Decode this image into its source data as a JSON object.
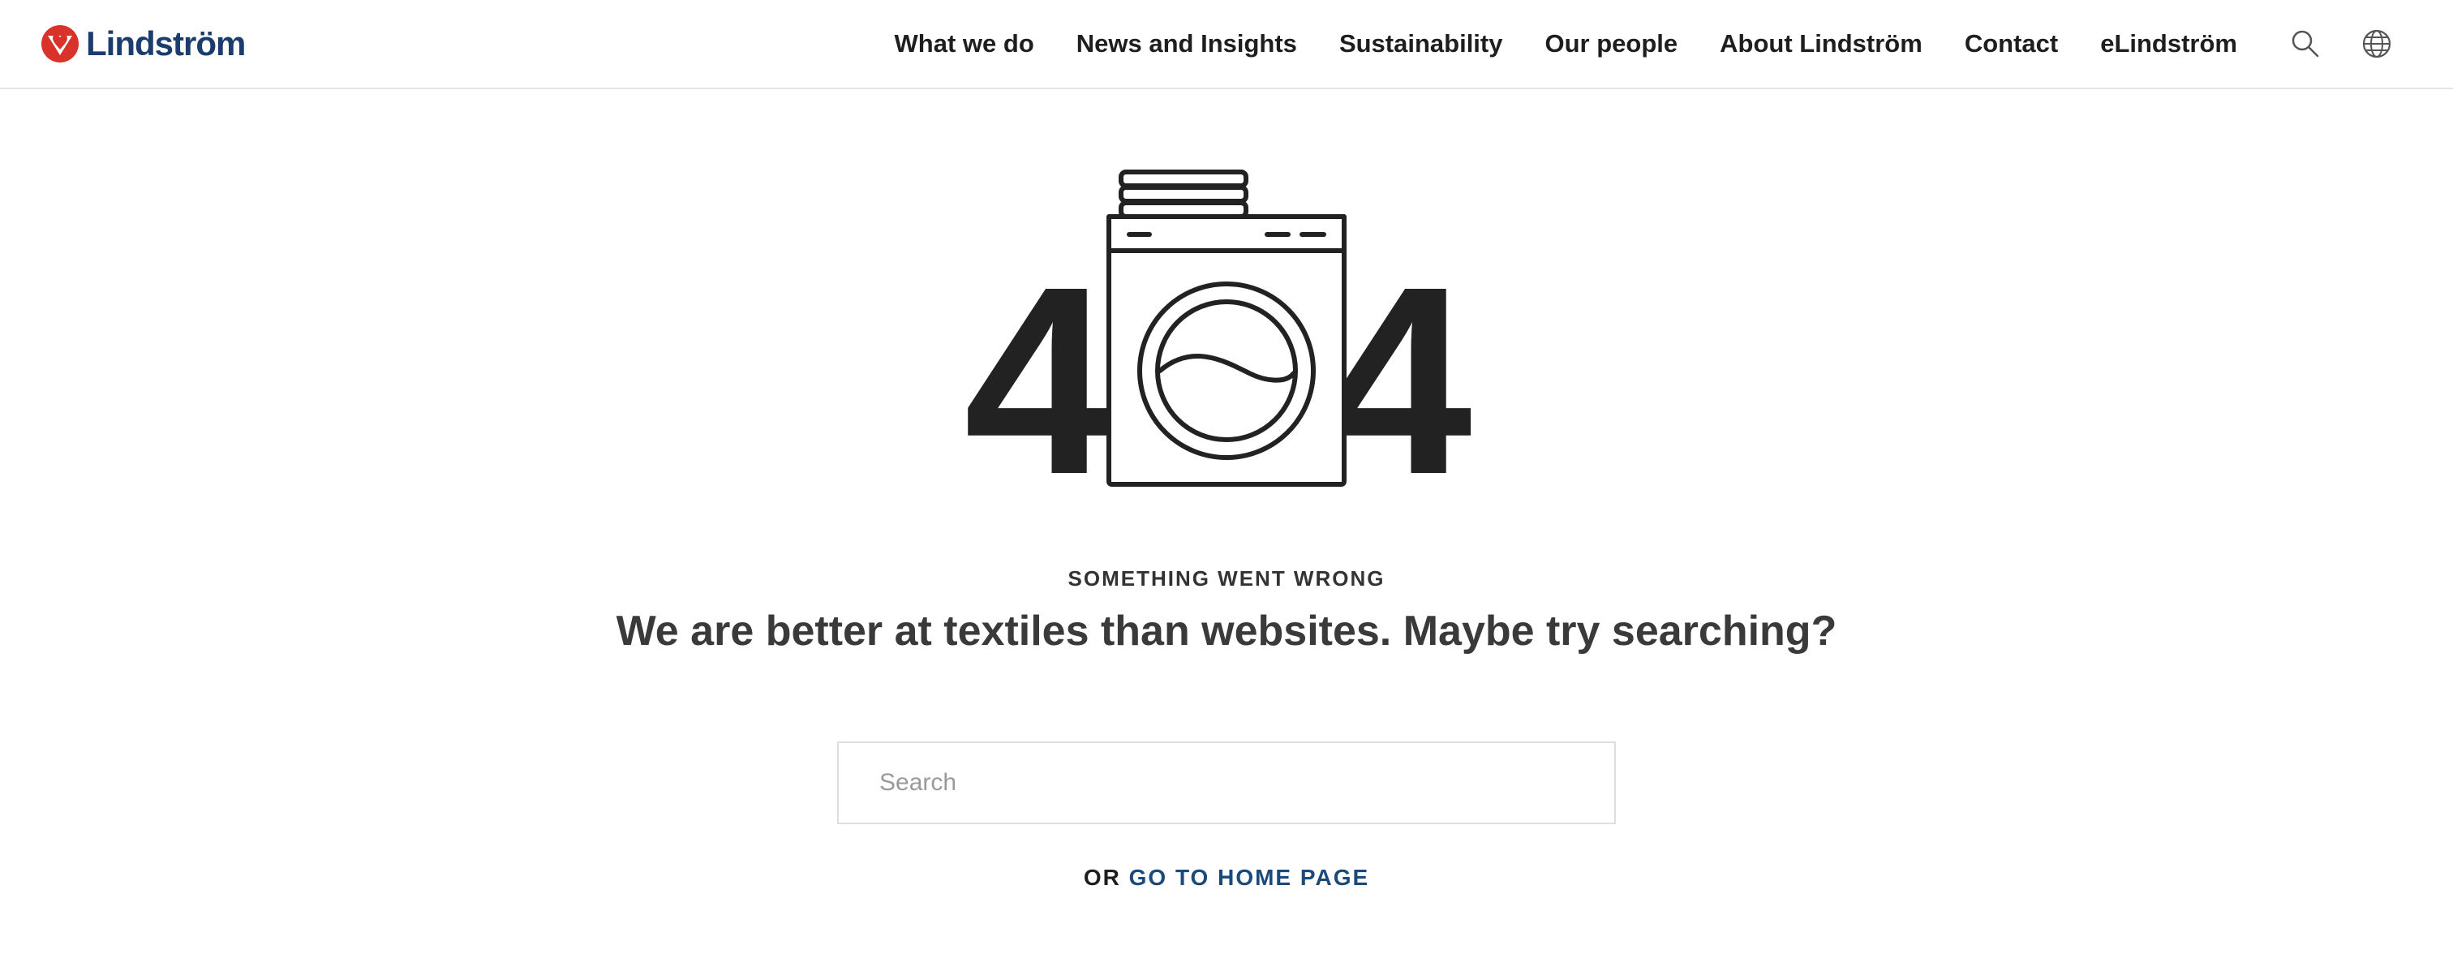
{
  "brand": {
    "name": "Lindström",
    "logo_icon": "lindstrom-heart-logo-icon",
    "colors": {
      "logo_red": "#d8322a",
      "logo_blue": "#1b3d6e",
      "link_blue": "#1b4a7a"
    }
  },
  "nav": {
    "items": [
      {
        "label": "What we do"
      },
      {
        "label": "News and Insights"
      },
      {
        "label": "Sustainability"
      },
      {
        "label": "Our people"
      },
      {
        "label": "About Lindström"
      },
      {
        "label": "Contact"
      },
      {
        "label": "eLindström"
      }
    ],
    "icons": [
      "search-icon",
      "globe-icon"
    ]
  },
  "error": {
    "left_digit": "4",
    "right_digit": "4",
    "middle_icon": "washing-machine-icon",
    "eyebrow": "SOMETHING WENT WRONG",
    "headline": "We are better at textiles than websites. Maybe try searching?"
  },
  "search": {
    "placeholder": "Search",
    "value": ""
  },
  "home": {
    "prefix": "OR",
    "link_label": "GO TO HOME PAGE"
  }
}
